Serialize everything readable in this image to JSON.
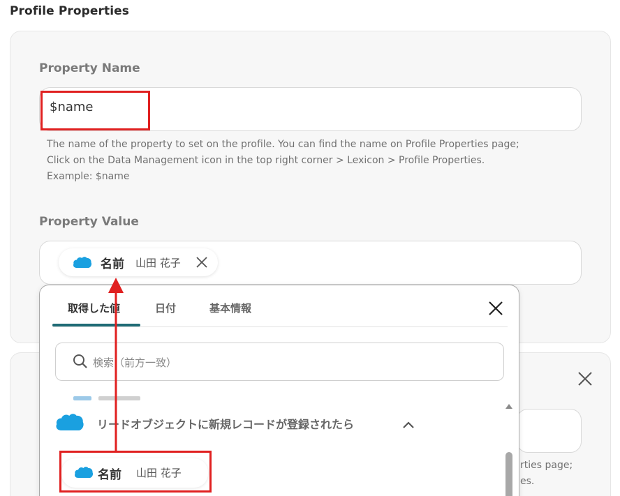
{
  "section": {
    "title": "Profile Properties"
  },
  "property_name": {
    "label": "Property Name",
    "value": "$name",
    "help": [
      "The name of the property to set on the profile. You can find the name on Profile Properties page;",
      "Click on the Data Management icon in the top right corner > Lexicon > Profile Properties.",
      "Example: $name"
    ]
  },
  "property_value": {
    "label": "Property Value",
    "chip": {
      "field": "名前",
      "value": "山田 花子",
      "icon": "salesforce-cloud-icon"
    }
  },
  "dropdown": {
    "tabs": [
      {
        "label": "取得した値",
        "active": true
      },
      {
        "label": "日付",
        "active": false
      },
      {
        "label": "基本情報",
        "active": false
      }
    ],
    "search_placeholder": "検索（前方一致）",
    "group": {
      "label": "リードオブジェクトに新規レコードが登録されたら",
      "icon": "salesforce-cloud-icon",
      "expanded": true
    },
    "item": {
      "field": "名前",
      "value": "山田 花子"
    }
  },
  "second_panel": {
    "help_partial": [
      "rties page;",
      "es."
    ]
  },
  "colors": {
    "accent": "#1f6b75",
    "highlight": "#e02020",
    "salesforce": "#1aa0e0"
  }
}
